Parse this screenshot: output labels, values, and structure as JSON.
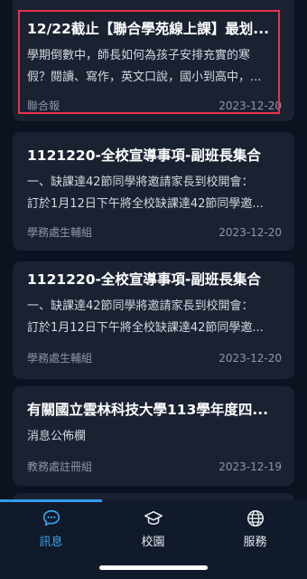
{
  "news": [
    {
      "title": "12/22截止【聯合學苑線上課】最划...",
      "body_lines": [
        "學期倒數中，師長如何為孩子安排充實的寒",
        "假？閱讀、寫作，英文口說，國小到高中，..."
      ],
      "source": "聯合報",
      "date": "2023-12-20"
    },
    {
      "title": "1121220-全校宣導事項-副班長集合",
      "body_lines": [
        "一、缺課達42節同學將邀請家長到校開會：",
        "訂於1月12日下午將全校缺課達42節同學邀..."
      ],
      "source": "學務處生輔組",
      "date": "2023-12-20"
    },
    {
      "title": "1121220-全校宣導事項-副班長集合",
      "body_lines": [
        "一、缺課達42節同學將邀請家長到校開會：",
        "訂於1月12日下午將全校缺課達42節同學邀..."
      ],
      "source": "學務處生輔組",
      "date": "2023-12-20"
    },
    {
      "title": "有關國立雲林科技大學113學年度四...",
      "body_lines": [
        "消息公佈欄"
      ],
      "source": "教務處註冊組",
      "date": "2023-12-19"
    }
  ],
  "tabs": [
    {
      "label": "訊息",
      "icon": "chat-bubble-icon",
      "active": true
    },
    {
      "label": "校園",
      "icon": "graduation-cap-icon",
      "active": false
    },
    {
      "label": "服務",
      "icon": "globe-icon",
      "active": false
    }
  ],
  "colors": {
    "background": "#0b1320",
    "card": "#1a2232",
    "accent": "#3aa3ef",
    "highlight_border": "#e8334b"
  }
}
